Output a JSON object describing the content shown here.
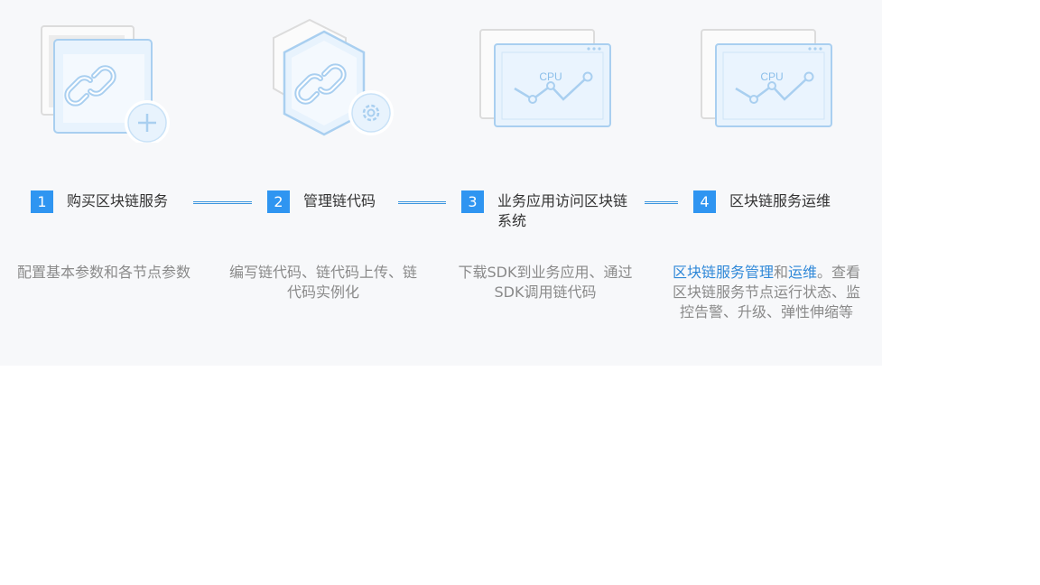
{
  "steps": [
    {
      "number": "1",
      "title": "购买区块链服务",
      "icon": "chain-add-icon",
      "description": "配置基本参数和各节点参数"
    },
    {
      "number": "2",
      "title": "管理链代码",
      "icon": "chain-settings-icon",
      "description": "编写链代码、链代码上传、链代码实例化"
    },
    {
      "number": "3",
      "title": "业务应用访问区块链系统",
      "icon": "cpu-monitor-icon",
      "cpu_label": "CPU",
      "description": "下载SDK到业务应用、通过SDK调用链代码"
    },
    {
      "number": "4",
      "title": "区块链服务运维",
      "icon": "cpu-monitor-icon",
      "cpu_label": "CPU",
      "description_link_1": "区块链服务管理",
      "description_mid": "和",
      "description_link_2": "运维",
      "description_rest": "。查看区块链服务节点运行状态、监控告警、升级、弹性伸缩等"
    }
  ],
  "colors": {
    "accent": "#2f95f1",
    "link": "#2f88d8",
    "panel_bg": "#f7f8fa",
    "icon_stroke": "#a9cff0",
    "icon_fill": "#e8f3fd"
  }
}
